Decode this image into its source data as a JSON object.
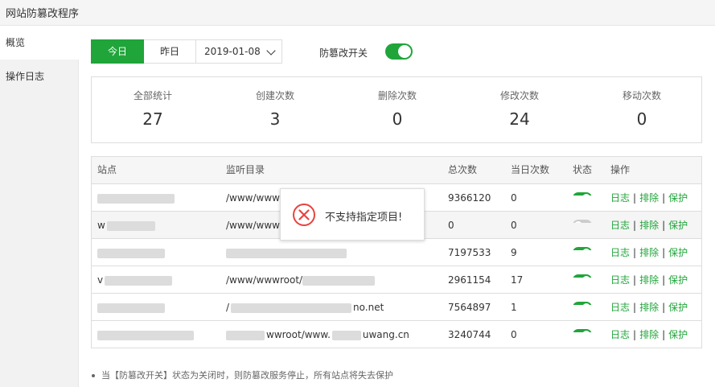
{
  "window": {
    "title": "网站防篡改程序"
  },
  "sidebar": {
    "items": [
      {
        "label": "概览"
      },
      {
        "label": "操作日志"
      }
    ]
  },
  "toolbar": {
    "today_label": "今日",
    "yesterday_label": "昨日",
    "date_value": "2019-01-08",
    "switch_label": "防篡改开关",
    "switch_on": true
  },
  "stats": [
    {
      "label": "全部统计",
      "value": "27"
    },
    {
      "label": "创建次数",
      "value": "3"
    },
    {
      "label": "删除次数",
      "value": "0"
    },
    {
      "label": "修改次数",
      "value": "24"
    },
    {
      "label": "移动次数",
      "value": "0"
    }
  ],
  "table": {
    "headers": {
      "site": "站点",
      "dir": "监听目录",
      "total": "总次数",
      "today": "当日次数",
      "status": "状态",
      "ops": "操作"
    },
    "op_labels": {
      "log": "日志",
      "exclude": "排除",
      "protect": "保护",
      "sep": "|"
    },
    "rows": [
      {
        "site": "",
        "dir": "/www/www",
        "total": "9366120",
        "today": "0",
        "enabled": true
      },
      {
        "site": "w",
        "dir": "/www/www",
        "total": "0",
        "today": "0",
        "enabled": false
      },
      {
        "site": "",
        "dir": "",
        "total": "7197533",
        "today": "9",
        "enabled": true
      },
      {
        "site": "v",
        "dir": "/www/wwwroot/",
        "total": "2961154",
        "today": "17",
        "enabled": true
      },
      {
        "site": "",
        "dir": "/",
        "dir_tail": "no.net",
        "total": "7564897",
        "today": "1",
        "enabled": true
      },
      {
        "site": "",
        "dir": "wwroot/www.",
        "dir_tail": "uwang.cn",
        "total": "3240744",
        "today": "0",
        "enabled": true
      }
    ]
  },
  "toast": {
    "message": "不支持指定项目!",
    "icon": "error-circle-icon",
    "color": "#e8433f"
  },
  "note": {
    "text": "当【防篡改开关】状态为关闭时，则防篡改服务停止，所有站点将失去保护"
  },
  "colors": {
    "accent": "#20a53a",
    "error": "#e8433f"
  }
}
